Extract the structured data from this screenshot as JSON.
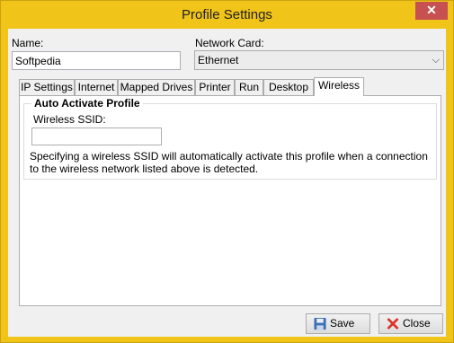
{
  "window": {
    "title": "Profile Settings",
    "close_glyph": "✕"
  },
  "form": {
    "name_label": "Name:",
    "name_value": "Softpedia",
    "network_card_label": "Network Card:",
    "network_card_value": "Ethernet"
  },
  "tabs": [
    {
      "label": "IP Settings"
    },
    {
      "label": "Internet"
    },
    {
      "label": "Mapped Drives"
    },
    {
      "label": "Printer"
    },
    {
      "label": "Run"
    },
    {
      "label": "Desktop"
    },
    {
      "label": "Wireless",
      "active": true
    }
  ],
  "wireless": {
    "group_title": "Auto Activate Profile",
    "ssid_label": "Wireless SSID:",
    "ssid_value": "",
    "description": "Specifying a wireless SSID will automatically activate this profile when a connection to the wireless network listed above is detected."
  },
  "buttons": {
    "save_label": "Save",
    "close_label": "Close"
  },
  "colors": {
    "title_bar": "#f0c419",
    "close_button": "#c75050",
    "save_icon": "#3b6fb6",
    "close_icon": "#d9362b"
  },
  "icons": {
    "save": "floppy-disk-icon",
    "close": "red-x-icon",
    "combo": "chevron-down-icon"
  }
}
